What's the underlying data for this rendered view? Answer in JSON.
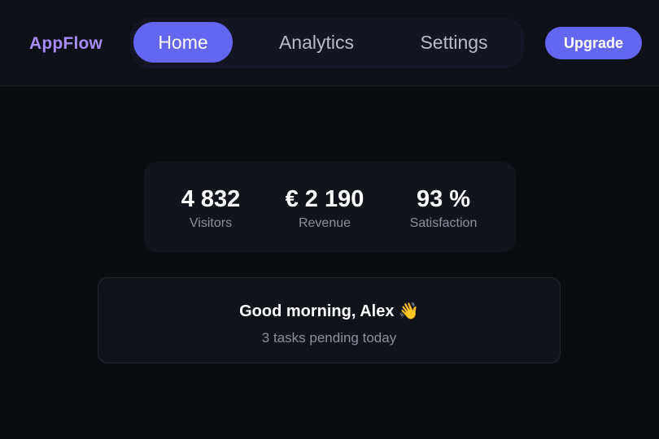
{
  "header": {
    "brand": "AppFlow",
    "tabs": [
      {
        "label": "Home",
        "active": true
      },
      {
        "label": "Analytics",
        "active": false
      },
      {
        "label": "Settings",
        "active": false
      }
    ],
    "upgrade_label": "Upgrade"
  },
  "stats": [
    {
      "value": "4 832",
      "label": "Visitors"
    },
    {
      "value": "€ 2 190",
      "label": "Revenue"
    },
    {
      "value": "93 %",
      "label": "Satisfaction"
    }
  ],
  "greeting": {
    "title": "Good morning, Alex 👋",
    "subtitle": "3 tasks pending today"
  },
  "colors": {
    "accent": "#6366f1",
    "brand": "#a78bfa",
    "background": "#0b0c10"
  }
}
